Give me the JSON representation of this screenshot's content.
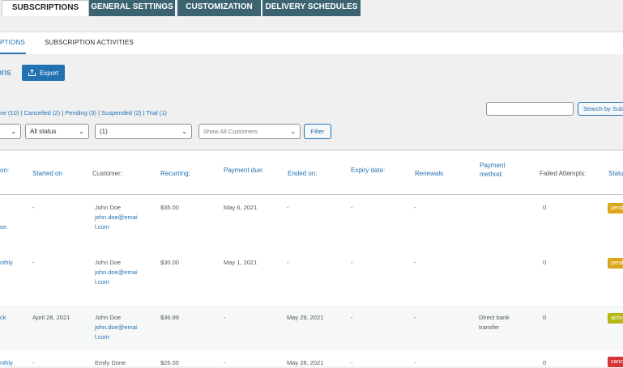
{
  "top_tabs": [
    "SUBSCRIPTIONS",
    "GENERAL SETTINGS",
    "CUSTOMIZATION",
    "DELIVERY SCHEDULES"
  ],
  "sub_tabs": [
    "PTIONS",
    "SUBSCRIPTION ACTIVITIES"
  ],
  "heading": "ons",
  "export_label": "Export",
  "filter_links": {
    "active": "ve (10)",
    "cancelled": "Cancelled (2)",
    "pending": "Pending (3)",
    "suspended": "Suspended (2)",
    "trial": "Trial (1)",
    "sep": "|"
  },
  "search": {
    "value": "",
    "button": "Search by Sub"
  },
  "selects": {
    "first": "",
    "status": "All status",
    "product": "(1)",
    "customers": "Show All Customers"
  },
  "filter_button": "Filter",
  "columns": {
    "subscription": "on:",
    "started": "Started on",
    "customer": "Customer:",
    "recurring": "Recurring:",
    "payment_due": "Payment due:",
    "ended": "Ended on:",
    "expiry": "Expiry date:",
    "renewals": "Renewals",
    "payment_method_1": "Payment",
    "payment_method_2": "method:",
    "failed": "Failed Attempts:",
    "status": "Statu"
  },
  "rows": [
    {
      "product_1": "",
      "product_2": "on",
      "started": "-",
      "customer_name": "John Doe",
      "email_1": "john.doe@emai",
      "email_2": "l.com",
      "recurring": "$35.00",
      "payment_due": "May 6, 2021",
      "ended": "-",
      "expiry": "-",
      "renewals": "-",
      "method_1": "",
      "method_2": "",
      "failed": "0",
      "status": "pend"
    },
    {
      "product_1": "nthly",
      "product_2": "",
      "started": "-",
      "customer_name": "John Doe",
      "email_1": "john.doe@emai",
      "email_2": "l.com",
      "recurring": "$30.00",
      "payment_due": "May 1, 2021",
      "ended": "-",
      "expiry": "-",
      "renewals": "-",
      "method_1": "",
      "method_2": "",
      "failed": "0",
      "status": "pend"
    },
    {
      "product_1": "ck",
      "product_2": "",
      "started": "April 28, 2021",
      "customer_name": "John Doe",
      "email_1": "john.doe@emai",
      "email_2": "l.com",
      "recurring": "$36.99",
      "payment_due": "-",
      "ended": "May 29, 2021",
      "expiry": "-",
      "renewals": "-",
      "method_1": "Direct bank",
      "method_2": "transfer",
      "failed": "0",
      "status": "activ"
    },
    {
      "product_1": "nthly",
      "product_2": "",
      "started": "-",
      "customer_name": "Emily Done",
      "email_1": "",
      "email_2": "",
      "recurring": "$26.00",
      "payment_due": "-",
      "ended": "May 28, 2021",
      "expiry": "-",
      "renewals": "-",
      "method_1": "",
      "method_2": "",
      "failed": "0",
      "status": "canc"
    }
  ],
  "colors": {
    "pending": "#dba617",
    "active": "#b5b514",
    "cancelled": "#d63638",
    "accent": "#2271b1",
    "tab": "#3c6470"
  }
}
